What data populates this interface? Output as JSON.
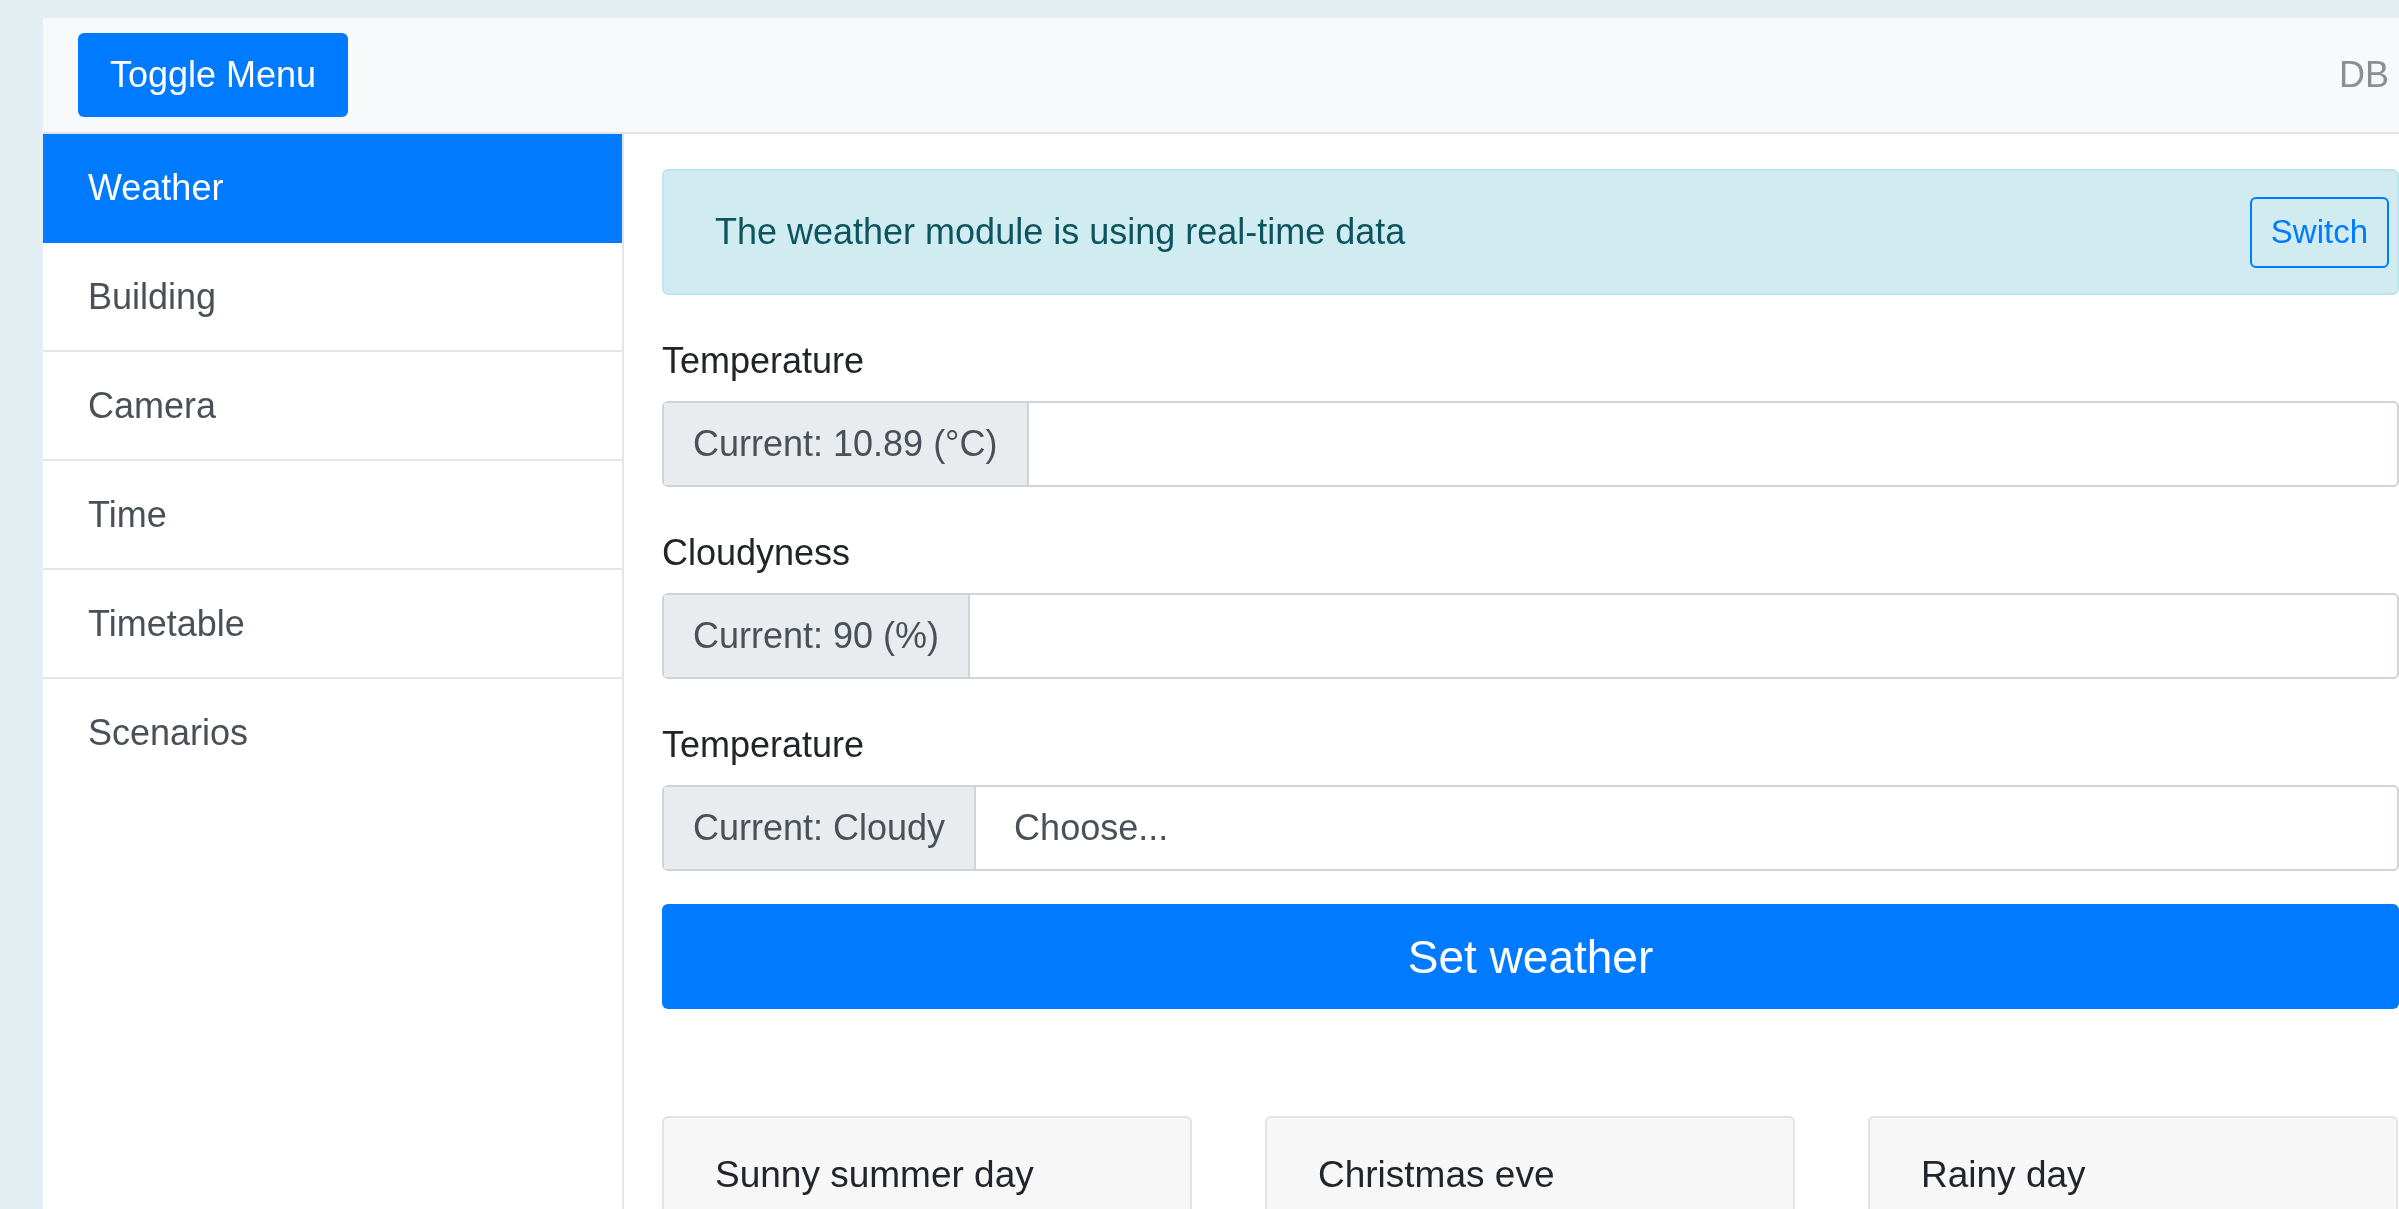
{
  "navbar": {
    "toggle_button": "Toggle Menu",
    "brand": "DB"
  },
  "sidebar": {
    "items": [
      {
        "label": "Weather",
        "selected": true
      },
      {
        "label": "Building",
        "selected": false
      },
      {
        "label": "Camera",
        "selected": false
      },
      {
        "label": "Time",
        "selected": false
      },
      {
        "label": "Timetable",
        "selected": false
      },
      {
        "label": "Scenarios",
        "selected": false
      }
    ]
  },
  "alert": {
    "message": "The weather module is using real-time data",
    "button": "Switch"
  },
  "fields": [
    {
      "kind": "input",
      "label": "Temperature",
      "prefix": "Current: 10.89 (°C)"
    },
    {
      "kind": "input",
      "label": "Cloudyness",
      "prefix": "Current: 90 (%)"
    },
    {
      "kind": "select",
      "label": "Temperature",
      "prefix": "Current: Cloudy",
      "value": "Choose..."
    }
  ],
  "submit": "Set weather",
  "scenarios": [
    {
      "title": "Sunny summer day"
    },
    {
      "title": "Christmas eve"
    },
    {
      "title": "Rainy day"
    }
  ]
}
